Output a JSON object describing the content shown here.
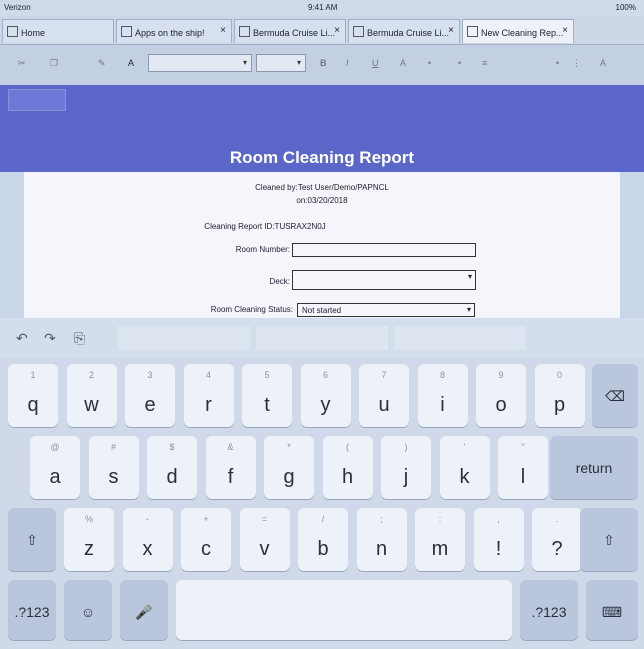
{
  "status": {
    "left": "Verizon",
    "time": "9:41 AM",
    "battery": "100%"
  },
  "tabs": [
    {
      "label": "Home"
    },
    {
      "label": "Apps on the ship!"
    },
    {
      "label": "Bermuda Cruise Li..."
    },
    {
      "label": "Bermuda Cruise Li..."
    },
    {
      "label": "New Cleaning Rep..."
    }
  ],
  "tab_close": "×",
  "toolbar": {
    "bold": "B",
    "italic": "I",
    "underline": "U",
    "align": "≡"
  },
  "report": {
    "title": "Room Cleaning Report",
    "cleaned_by": "Cleaned by:Test User/Demo/PAPNCL",
    "cleaned_on": "on:03/20/2018",
    "report_id": "Cleaning Report ID:TUSRAX2N0J",
    "room_number_label": "Room Number:",
    "room_number_value": "",
    "deck_label": "Deck:",
    "deck_value": "",
    "status_label": "Room Cleaning Status:",
    "status_value": "Not started"
  },
  "keyboard": {
    "row1": [
      {
        "k": "q",
        "h": "1"
      },
      {
        "k": "w",
        "h": "2"
      },
      {
        "k": "e",
        "h": "3"
      },
      {
        "k": "r",
        "h": "4"
      },
      {
        "k": "t",
        "h": "5"
      },
      {
        "k": "y",
        "h": "6"
      },
      {
        "k": "u",
        "h": "7"
      },
      {
        "k": "i",
        "h": "8"
      },
      {
        "k": "o",
        "h": "9"
      },
      {
        "k": "p",
        "h": "0"
      }
    ],
    "row2": [
      {
        "k": "a",
        "h": "@"
      },
      {
        "k": "s",
        "h": "#"
      },
      {
        "k": "d",
        "h": "$"
      },
      {
        "k": "f",
        "h": "&"
      },
      {
        "k": "g",
        "h": "*"
      },
      {
        "k": "h",
        "h": "("
      },
      {
        "k": "j",
        "h": ")"
      },
      {
        "k": "k",
        "h": "'"
      },
      {
        "k": "l",
        "h": "\""
      }
    ],
    "row3": [
      {
        "k": "z",
        "h": "%"
      },
      {
        "k": "x",
        "h": "-"
      },
      {
        "k": "c",
        "h": "+"
      },
      {
        "k": "v",
        "h": "="
      },
      {
        "k": "b",
        "h": "/"
      },
      {
        "k": "n",
        "h": ";"
      },
      {
        "k": "m",
        "h": ":"
      },
      {
        "k": "!",
        "h": ","
      },
      {
        "k": "?",
        "h": "."
      }
    ],
    "return": "return",
    "num": ".?123",
    "backspace": "⌫",
    "shift": "⇧",
    "emoji": "☺",
    "mic": "🎤",
    "hide": "⌨"
  }
}
